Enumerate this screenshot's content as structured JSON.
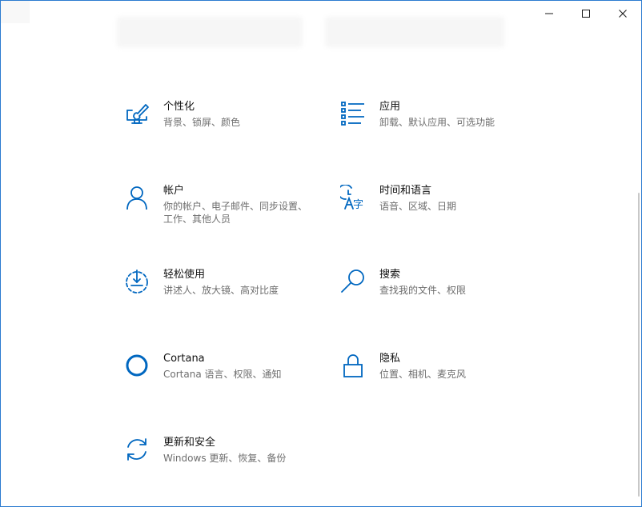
{
  "window": {
    "controls": {
      "minimize": "minimize-icon",
      "maximize": "maximize-icon",
      "close": "close-icon"
    }
  },
  "accent_color": "#0067c0",
  "tiles": [
    {
      "icon": "personalization-icon",
      "title": "个性化",
      "desc": "背景、锁屏、颜色"
    },
    {
      "icon": "apps-icon",
      "title": "应用",
      "desc": "卸载、默认应用、可选功能"
    },
    {
      "icon": "accounts-icon",
      "title": "帐户",
      "desc": "你的帐户、电子邮件、同步设置、工作、其他人员"
    },
    {
      "icon": "time-language-icon",
      "title": "时间和语言",
      "desc": "语音、区域、日期"
    },
    {
      "icon": "ease-of-access-icon",
      "title": "轻松使用",
      "desc": "讲述人、放大镜、高对比度"
    },
    {
      "icon": "search-icon",
      "title": "搜索",
      "desc": "查找我的文件、权限"
    },
    {
      "icon": "cortana-icon",
      "title": "Cortana",
      "desc": "Cortana 语言、权限、通知"
    },
    {
      "icon": "privacy-lock-icon",
      "title": "隐私",
      "desc": "位置、相机、麦克风"
    },
    {
      "icon": "update-security-icon",
      "title": "更新和安全",
      "desc": "Windows 更新、恢复、备份"
    }
  ]
}
